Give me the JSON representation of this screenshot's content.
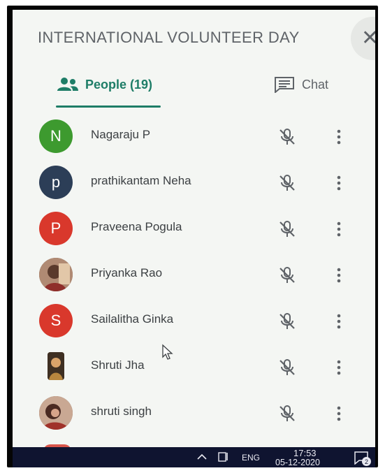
{
  "panel": {
    "title": "INTERNATIONAL VOLUNTEER DAY",
    "close_glyph": "✕"
  },
  "tabs": {
    "people_label": "People (19)",
    "chat_label": "Chat"
  },
  "colors": {
    "accent": "#1e7d67",
    "avatar_green": "#3d9a2f",
    "avatar_navy": "#2c3e57",
    "avatar_red": "#d9382c",
    "mic_muted": "#5f6368"
  },
  "participants": [
    {
      "initial": "N",
      "name": "Nagaraju P",
      "avatar_type": "letter",
      "color": "#3d9a2f"
    },
    {
      "initial": "p",
      "name": "prathikantam Neha",
      "avatar_type": "letter",
      "color": "#2c3e57"
    },
    {
      "initial": "P",
      "name": "Praveena Pogula",
      "avatar_type": "letter",
      "color": "#d9382c"
    },
    {
      "initial": "",
      "name": "Priyanka Rao",
      "avatar_type": "photo",
      "color": "#8b6a55"
    },
    {
      "initial": "S",
      "name": "Sailalitha Ginka",
      "avatar_type": "letter",
      "color": "#d9382c"
    },
    {
      "initial": "",
      "name": "Shruti Jha",
      "avatar_type": "square",
      "color": "#6b5138"
    },
    {
      "initial": "",
      "name": "shruti singh",
      "avatar_type": "photo",
      "color": "#7a4a3c"
    }
  ],
  "taskbar": {
    "language": "ENG",
    "time": "17:53",
    "date": "05-12-2020",
    "notification_count": "2"
  }
}
